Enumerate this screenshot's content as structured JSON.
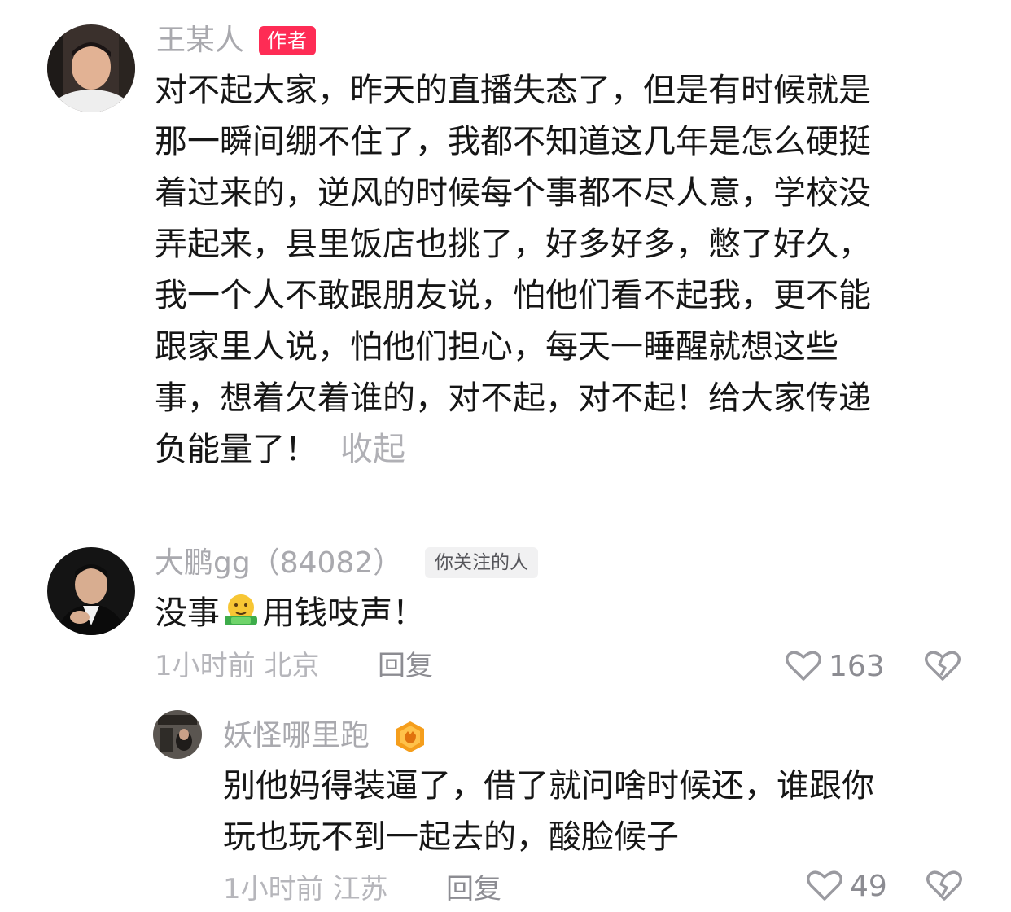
{
  "author_comment": {
    "username": "王某人",
    "badge": "作者",
    "lines": [
      "对不起大家，昨天的直播失态了，但是有时候就是",
      "那一瞬间绷不住了，我都不知道这几年是怎么硬挺",
      "着过来的，逆风的时候每个事都不尽人意，学校没",
      "弄起来，县里饭店也挑了，好多好多，憋了好久，",
      "我一个人不敢跟朋友说，怕他们看不起我，更不能",
      "跟家里人说，怕他们担心，每天一睡醒就想这些",
      "事，想着欠着谁的，对不起，对不起！给大家传递",
      "负能量了！"
    ],
    "collapse_label": "收起"
  },
  "comment_1": {
    "username": "大鹏gg（84082）",
    "badge": "你关注的人",
    "text_before": "没事",
    "emoji_icon": "money-mouth-hug-emoji",
    "text_after": "用钱吱声！",
    "meta": "1小时前 北京",
    "reply_label": "回复",
    "like_count": "163"
  },
  "reply_1": {
    "username": "妖怪哪里跑",
    "level_icon": "orange-hexagon-badge-icon",
    "lines": [
      "别他妈得装逼了，借了就问啥时候还，谁跟你",
      "玩也玩不到一起去的，酸脸候子"
    ],
    "meta": "1小时前 江苏",
    "reply_label": "回复",
    "like_count": "49"
  },
  "colors": {
    "author_badge": "#fe2c55",
    "muted_text": "#a9a9ae",
    "body_text": "#161616",
    "hex_badge": "#f59e1c"
  }
}
